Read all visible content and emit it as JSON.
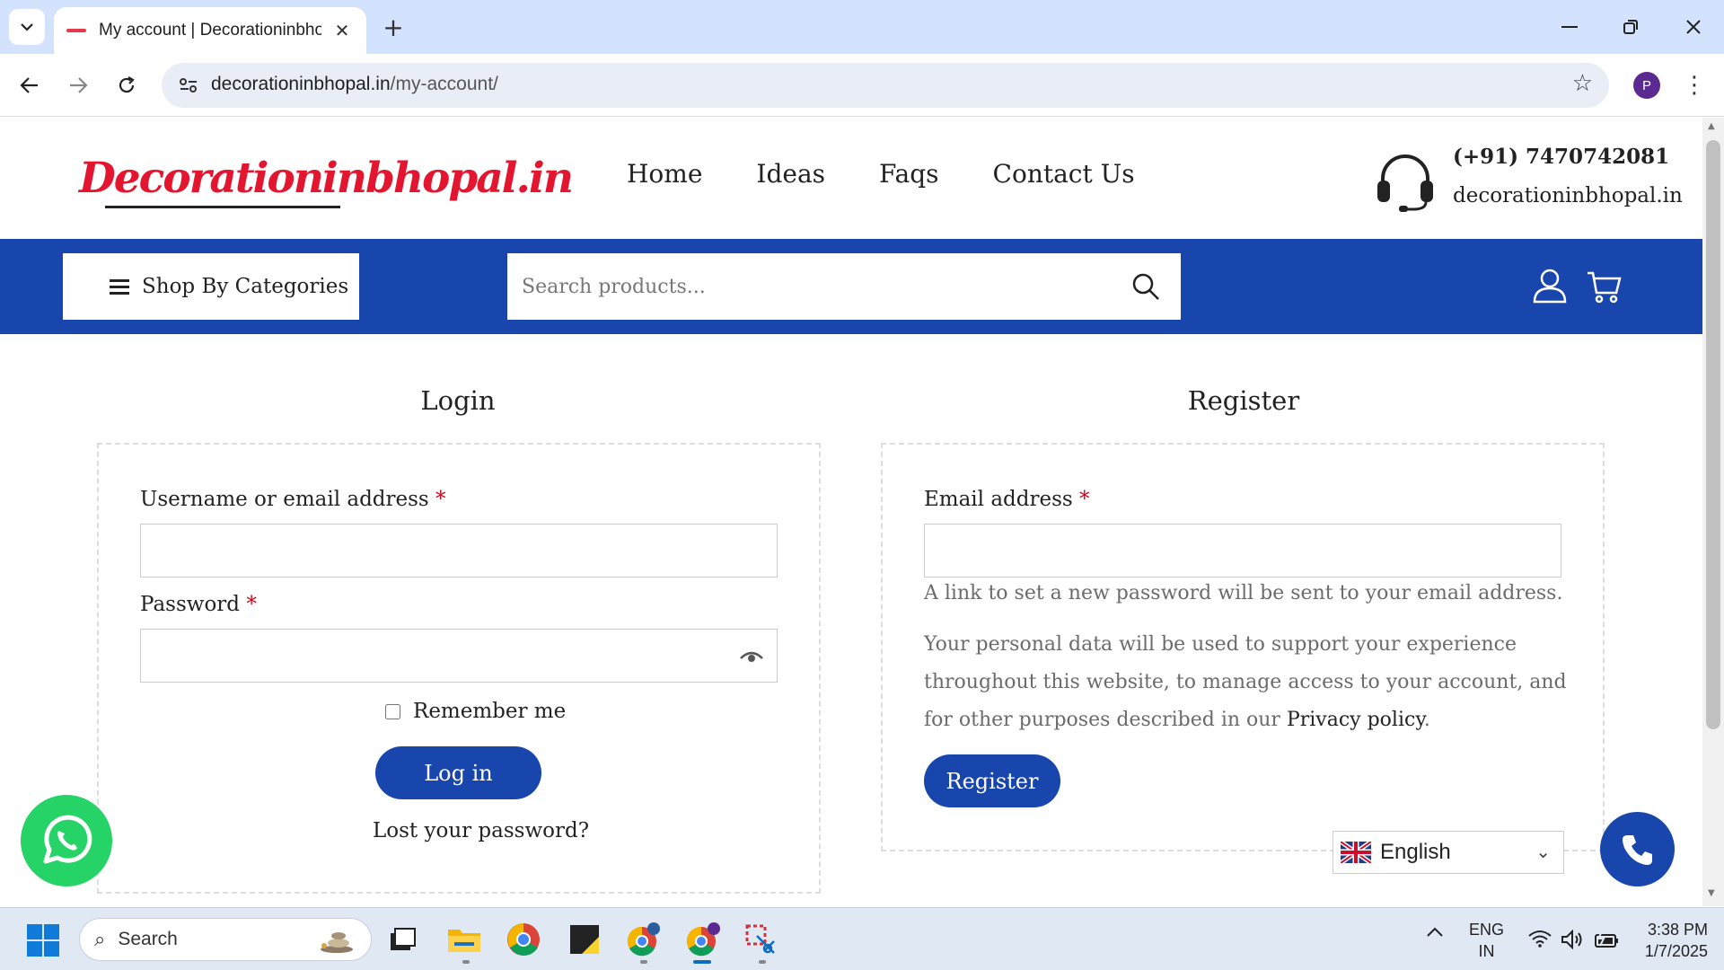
{
  "browser": {
    "tab_title": "My account | Decorationinbhopal",
    "url_domain": "decorationinbhopal.in",
    "url_path": "/my-account/",
    "profile_initial": "P"
  },
  "site": {
    "logo_text": "Decorationinbhopal.in",
    "nav": [
      "Home",
      "Ideas",
      "Faqs",
      "Contact Us"
    ],
    "phone": "(+91) 7470742081",
    "email": "decorationinbhopal.in",
    "categories_label": "Shop By Categories",
    "search_placeholder": "Search products...",
    "brand_blue": "#1846ad",
    "logo_red": "#e4152f"
  },
  "login": {
    "title": "Login",
    "username_label": "Username or email address",
    "password_label": "Password",
    "required_mark": "*",
    "remember_label": "Remember me",
    "submit_label": "Log in",
    "lost_password": "Lost your password?"
  },
  "register": {
    "title": "Register",
    "email_label": "Email address",
    "required_mark": "*",
    "help_text": "A link to set a new password will be sent to your email address.",
    "privacy_text": "Your personal data will be used to support your experience throughout this website, to manage access to your account, and for other purposes described in our",
    "privacy_link": "Privacy policy",
    "privacy_end": ".",
    "submit_label": "Register"
  },
  "widgets": {
    "language": "English"
  },
  "taskbar": {
    "search_label": "Search",
    "lang_line1": "ENG",
    "lang_line2": "IN",
    "time": "3:38 PM",
    "date": "1/7/2025"
  }
}
